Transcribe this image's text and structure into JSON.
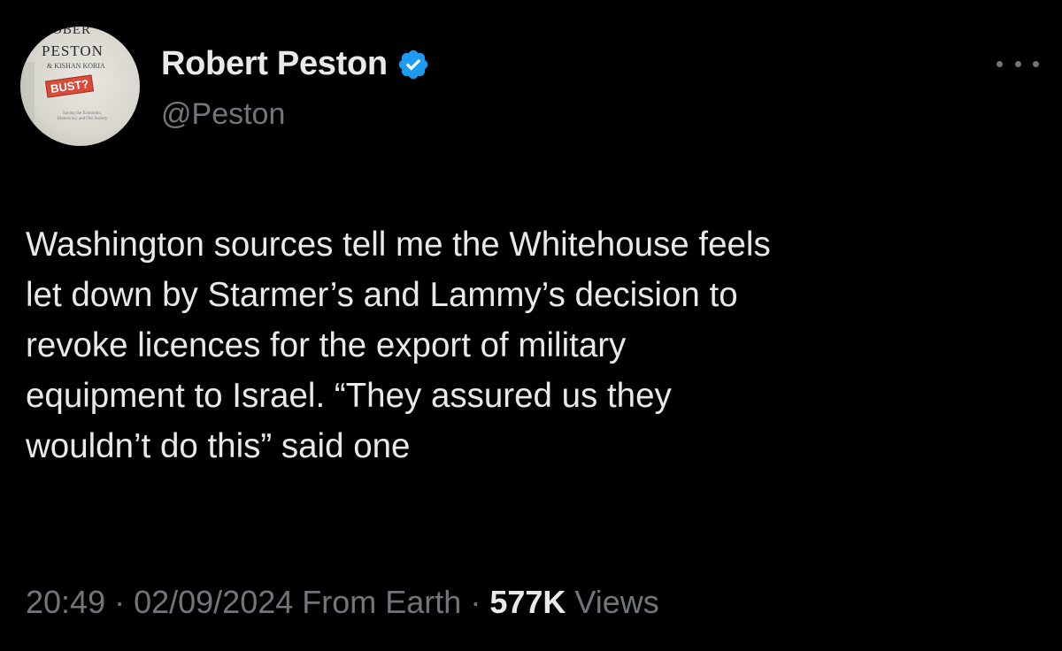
{
  "author": {
    "display_name": "Robert Peston",
    "handle": "@Peston",
    "verified": true,
    "verified_color": "#1d9bf0",
    "avatar": {
      "book_top": "OBER",
      "book_name": "PESTON",
      "book_coauthor": "& KISHAN KORIA",
      "book_badge": "BUST?",
      "book_subtitle": "Saving the Economic, Democracy and Our Society"
    }
  },
  "menu": {
    "icon": "more-horizontal-icon"
  },
  "tweet": {
    "text": "Washington sources tell me the Whitehouse feels\nlet down by Starmer’s and Lammy’s decision to\nrevoke licences for the export of military\nequipment to Israel. “They assured us they\nwouldn’t do this” said one"
  },
  "meta": {
    "time": "20:49",
    "separator1": " · ",
    "date": "02/09/2024",
    "source": " From Earth",
    "separator2": " · ",
    "views_count": "577K",
    "views_label": " Views"
  },
  "colors": {
    "background": "#000000",
    "primary_text": "#e7e9ea",
    "secondary_text": "#71767b",
    "accent": "#1d9bf0"
  }
}
